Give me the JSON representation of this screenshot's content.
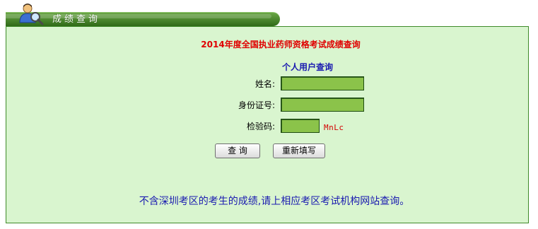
{
  "header": {
    "title": "成绩查询",
    "icon": "user-search-icon"
  },
  "main": {
    "page_title": "2014年度全国执业药师资格考试成绩查询",
    "section_title": "个人用户查询",
    "fields": {
      "name_label": "姓名:",
      "name_value": "",
      "id_label": "身份证号:",
      "id_value": "",
      "captcha_label": "检验码:",
      "captcha_value": "",
      "captcha_code": "MnLc"
    },
    "buttons": {
      "query": "查 询",
      "reset": "重新填写"
    },
    "notice": "不含深圳考区的考生的成绩,请上相应考区考试机构网站查询。"
  },
  "colors": {
    "header_green": "#2f6a18",
    "panel_bg": "#d9f5cf",
    "input_bg": "#8bc34a",
    "title_red": "#e00000",
    "text_blue": "#1a1ab0"
  }
}
